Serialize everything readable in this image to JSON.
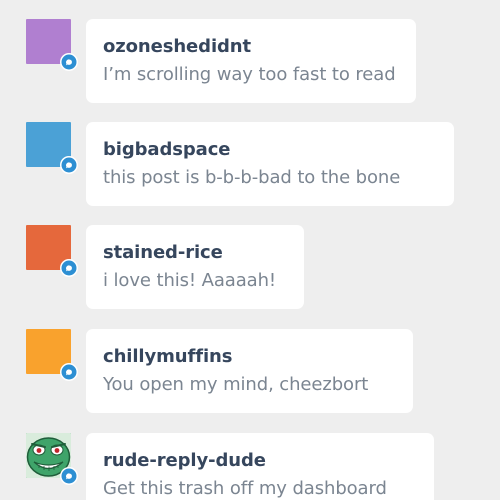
{
  "replies": [
    {
      "username": "ozoneshedidnt",
      "message": "I’m scrolling way too fast to read",
      "avatar_color": "#b07fd0",
      "avatar_icon": "purple-square-avatar"
    },
    {
      "username": "bigbadspace",
      "message": "this post is b-b-b-bad to the bone",
      "avatar_color": "#4ba1d6",
      "avatar_icon": "blue-square-avatar"
    },
    {
      "username": "stained-rice",
      "message": "i love this! Aaaaah!",
      "avatar_color": "#e5683c",
      "avatar_icon": "orange-red-square-avatar"
    },
    {
      "username": "chillymuffins",
      "message": "You open my mind, cheezbort",
      "avatar_color": "#f9a22d",
      "avatar_icon": "orange-square-avatar"
    },
    {
      "username": "rude-reply-dude",
      "message": "Get this trash off my dashboard",
      "avatar_color": "#3fa46a",
      "avatar_icon": "angry-green-face-avatar"
    }
  ],
  "badge_color": "#2d8fd3",
  "badge_icon": "reply-bubble-icon"
}
